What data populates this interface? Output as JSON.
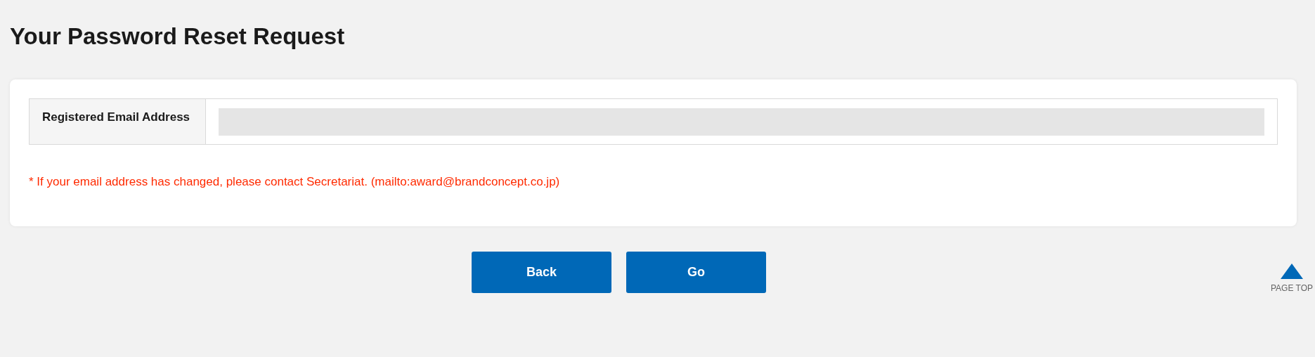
{
  "page_title": "Your Password Reset Request",
  "form": {
    "fields": [
      {
        "label": "Registered Email Address"
      }
    ],
    "note": "* If your email address has changed, please contact Secretariat. (mailto:award@brandconcept.co.jp)"
  },
  "buttons": [
    {
      "label": "Back"
    },
    {
      "label": "Go"
    }
  ],
  "page_top": {
    "label": "PAGE TOP"
  }
}
